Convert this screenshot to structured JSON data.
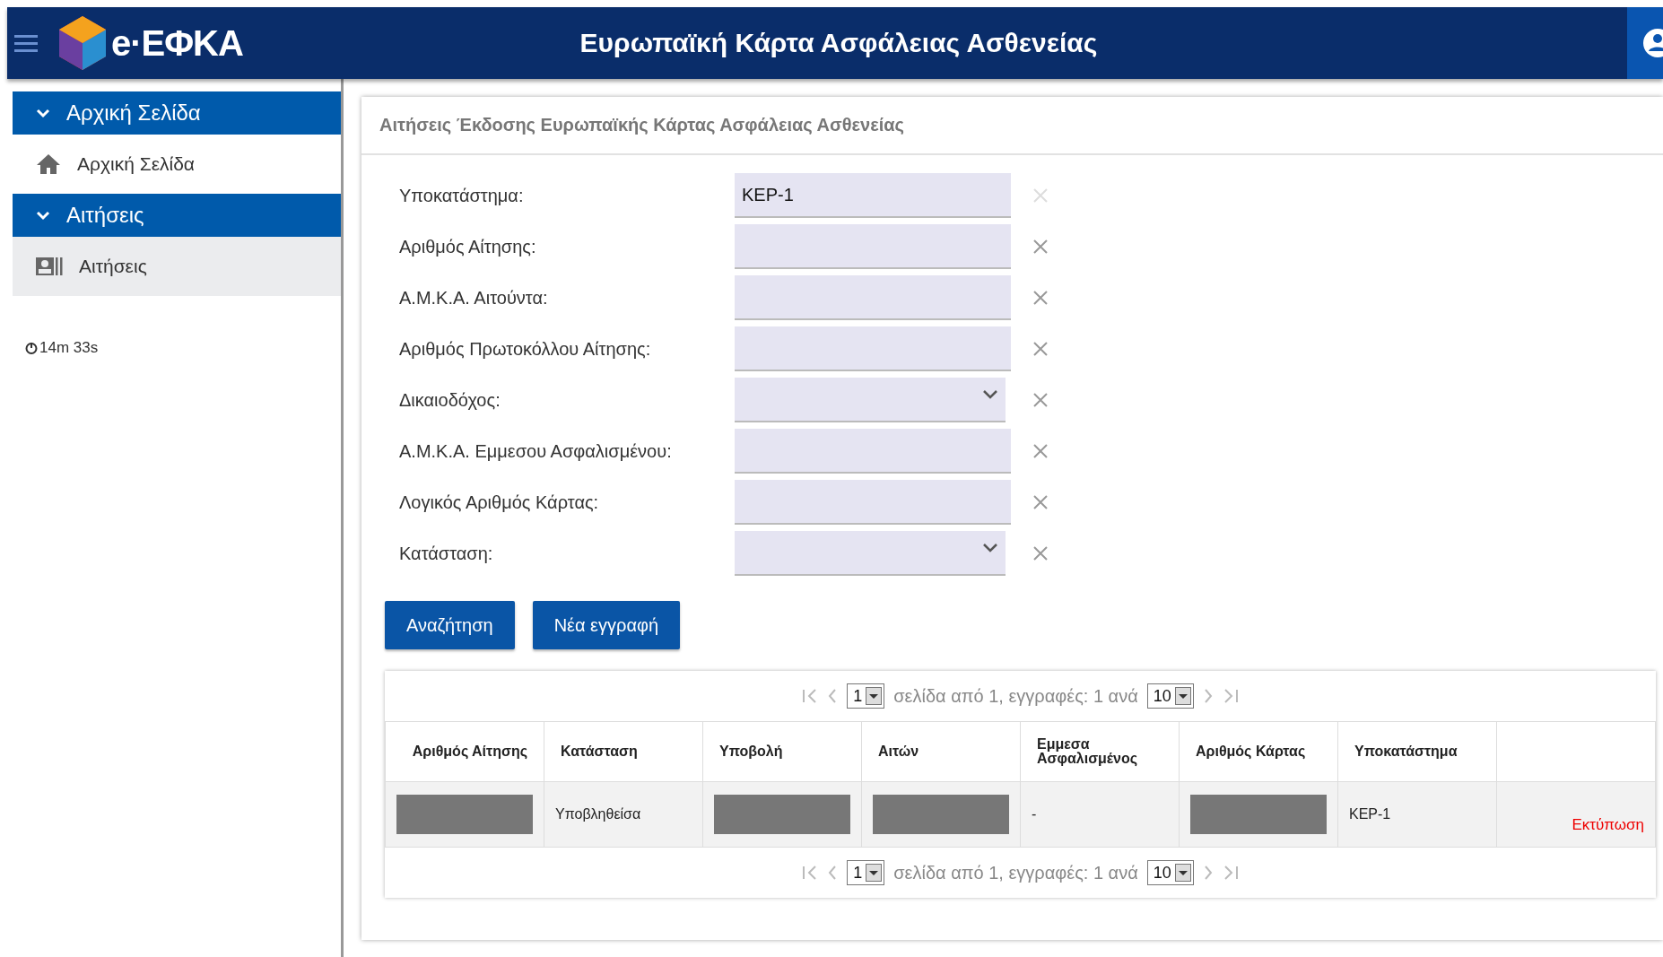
{
  "header": {
    "logo_text": "e·ΕΦΚΑ",
    "title": "Ευρωπαϊκή Κάρτα Ασφάλειας Ασθενείας"
  },
  "sidebar": {
    "sections": [
      {
        "label": "Αρχική Σελίδα",
        "expanded": true,
        "items": [
          {
            "label": "Αρχική Σελίδα",
            "selected": false
          }
        ]
      },
      {
        "label": "Αιτήσεις",
        "expanded": true,
        "items": [
          {
            "label": "Αιτήσεις",
            "selected": true
          }
        ]
      }
    ],
    "timer": "14m 33s"
  },
  "card": {
    "title": "Αιτήσεις Έκδοσης Ευρωπαϊκής Κάρτας Ασφάλειας Ασθενείας",
    "fields": [
      {
        "label": "Υποκατάστημα:",
        "kind": "text",
        "value": "ΚΕΡ-1",
        "clear_disabled": true
      },
      {
        "label": "Αριθμός Αίτησης:",
        "kind": "text",
        "clear_disabled": false
      },
      {
        "label": "Α.Μ.Κ.Α. Αιτούντα:",
        "kind": "text",
        "clear_disabled": false
      },
      {
        "label": "Αριθμός Πρωτοκόλλου Αίτησης:",
        "kind": "text",
        "clear_disabled": false
      },
      {
        "label": "Δικαιοδόχος:",
        "kind": "select",
        "clear_disabled": false
      },
      {
        "label": "Α.Μ.Κ.Α. Εμμεσου Ασφαλισμένου:",
        "kind": "text",
        "clear_disabled": false
      },
      {
        "label": "Λογικός Αριθμός Κάρτας:",
        "kind": "text",
        "clear_disabled": false
      },
      {
        "label": "Κατάσταση:",
        "kind": "select",
        "clear_disabled": false
      }
    ],
    "buttons": [
      "Αναζήτηση",
      "Νέα εγγραφή"
    ],
    "pager_top": {
      "page": "1",
      "text": "σελίδα από 1, εγγραφές: 1 ανά",
      "per_page": "10"
    },
    "table": {
      "columns": [
        "Αριθμός Αίτησης",
        "Κατάσταση",
        "Υποβολή",
        "Αιτών",
        "Εμμεσα Ασφαλισμένος",
        "Αριθμός Κάρτας",
        "Υποκατάστημα",
        ""
      ],
      "rows": [
        {
          "cells": [
            {
              "kind": "redacted"
            },
            {
              "kind": "text",
              "text": "Υποβληθείσα"
            },
            {
              "kind": "redacted"
            },
            {
              "kind": "redacted"
            },
            {
              "kind": "text",
              "text": "-"
            },
            {
              "kind": "redacted"
            },
            {
              "kind": "text",
              "text": "ΚΕΡ-1"
            },
            {
              "kind": "link",
              "text": "Εκτύπωση"
            }
          ]
        }
      ]
    },
    "pager_bottom": {
      "page": "1",
      "text": "σελίδα από 1, εγγραφές: 1 ανά",
      "per_page": "10"
    }
  }
}
